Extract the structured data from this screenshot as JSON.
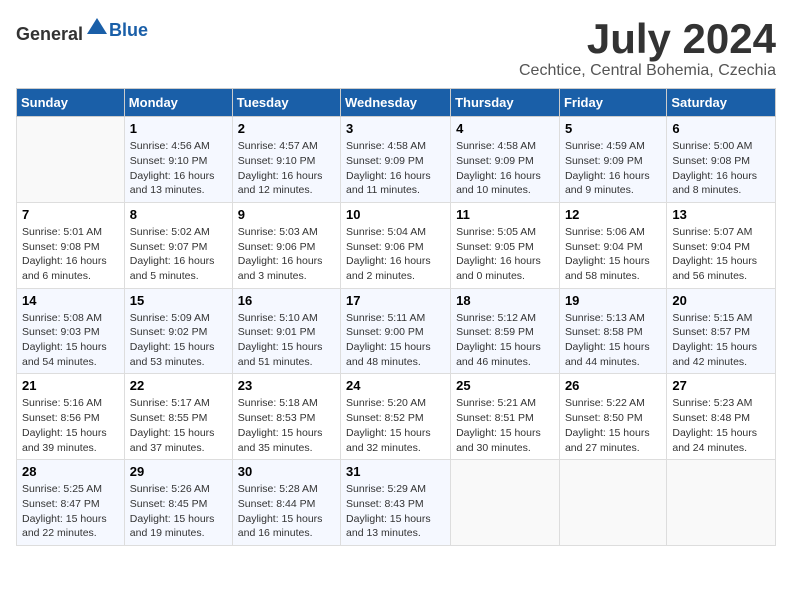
{
  "header": {
    "logo_general": "General",
    "logo_blue": "Blue",
    "month": "July 2024",
    "location": "Cechtice, Central Bohemia, Czechia"
  },
  "weekdays": [
    "Sunday",
    "Monday",
    "Tuesday",
    "Wednesday",
    "Thursday",
    "Friday",
    "Saturday"
  ],
  "weeks": [
    [
      {
        "day": null
      },
      {
        "day": "1",
        "sunrise": "4:56 AM",
        "sunset": "9:10 PM",
        "daylight": "16 hours and 13 minutes."
      },
      {
        "day": "2",
        "sunrise": "4:57 AM",
        "sunset": "9:10 PM",
        "daylight": "16 hours and 12 minutes."
      },
      {
        "day": "3",
        "sunrise": "4:58 AM",
        "sunset": "9:09 PM",
        "daylight": "16 hours and 11 minutes."
      },
      {
        "day": "4",
        "sunrise": "4:58 AM",
        "sunset": "9:09 PM",
        "daylight": "16 hours and 10 minutes."
      },
      {
        "day": "5",
        "sunrise": "4:59 AM",
        "sunset": "9:09 PM",
        "daylight": "16 hours and 9 minutes."
      },
      {
        "day": "6",
        "sunrise": "5:00 AM",
        "sunset": "9:08 PM",
        "daylight": "16 hours and 8 minutes."
      }
    ],
    [
      {
        "day": "7",
        "sunrise": "5:01 AM",
        "sunset": "9:08 PM",
        "daylight": "16 hours and 6 minutes."
      },
      {
        "day": "8",
        "sunrise": "5:02 AM",
        "sunset": "9:07 PM",
        "daylight": "16 hours and 5 minutes."
      },
      {
        "day": "9",
        "sunrise": "5:03 AM",
        "sunset": "9:06 PM",
        "daylight": "16 hours and 3 minutes."
      },
      {
        "day": "10",
        "sunrise": "5:04 AM",
        "sunset": "9:06 PM",
        "daylight": "16 hours and 2 minutes."
      },
      {
        "day": "11",
        "sunrise": "5:05 AM",
        "sunset": "9:05 PM",
        "daylight": "16 hours and 0 minutes."
      },
      {
        "day": "12",
        "sunrise": "5:06 AM",
        "sunset": "9:04 PM",
        "daylight": "15 hours and 58 minutes."
      },
      {
        "day": "13",
        "sunrise": "5:07 AM",
        "sunset": "9:04 PM",
        "daylight": "15 hours and 56 minutes."
      }
    ],
    [
      {
        "day": "14",
        "sunrise": "5:08 AM",
        "sunset": "9:03 PM",
        "daylight": "15 hours and 54 minutes."
      },
      {
        "day": "15",
        "sunrise": "5:09 AM",
        "sunset": "9:02 PM",
        "daylight": "15 hours and 53 minutes."
      },
      {
        "day": "16",
        "sunrise": "5:10 AM",
        "sunset": "9:01 PM",
        "daylight": "15 hours and 51 minutes."
      },
      {
        "day": "17",
        "sunrise": "5:11 AM",
        "sunset": "9:00 PM",
        "daylight": "15 hours and 48 minutes."
      },
      {
        "day": "18",
        "sunrise": "5:12 AM",
        "sunset": "8:59 PM",
        "daylight": "15 hours and 46 minutes."
      },
      {
        "day": "19",
        "sunrise": "5:13 AM",
        "sunset": "8:58 PM",
        "daylight": "15 hours and 44 minutes."
      },
      {
        "day": "20",
        "sunrise": "5:15 AM",
        "sunset": "8:57 PM",
        "daylight": "15 hours and 42 minutes."
      }
    ],
    [
      {
        "day": "21",
        "sunrise": "5:16 AM",
        "sunset": "8:56 PM",
        "daylight": "15 hours and 39 minutes."
      },
      {
        "day": "22",
        "sunrise": "5:17 AM",
        "sunset": "8:55 PM",
        "daylight": "15 hours and 37 minutes."
      },
      {
        "day": "23",
        "sunrise": "5:18 AM",
        "sunset": "8:53 PM",
        "daylight": "15 hours and 35 minutes."
      },
      {
        "day": "24",
        "sunrise": "5:20 AM",
        "sunset": "8:52 PM",
        "daylight": "15 hours and 32 minutes."
      },
      {
        "day": "25",
        "sunrise": "5:21 AM",
        "sunset": "8:51 PM",
        "daylight": "15 hours and 30 minutes."
      },
      {
        "day": "26",
        "sunrise": "5:22 AM",
        "sunset": "8:50 PM",
        "daylight": "15 hours and 27 minutes."
      },
      {
        "day": "27",
        "sunrise": "5:23 AM",
        "sunset": "8:48 PM",
        "daylight": "15 hours and 24 minutes."
      }
    ],
    [
      {
        "day": "28",
        "sunrise": "5:25 AM",
        "sunset": "8:47 PM",
        "daylight": "15 hours and 22 minutes."
      },
      {
        "day": "29",
        "sunrise": "5:26 AM",
        "sunset": "8:45 PM",
        "daylight": "15 hours and 19 minutes."
      },
      {
        "day": "30",
        "sunrise": "5:28 AM",
        "sunset": "8:44 PM",
        "daylight": "15 hours and 16 minutes."
      },
      {
        "day": "31",
        "sunrise": "5:29 AM",
        "sunset": "8:43 PM",
        "daylight": "15 hours and 13 minutes."
      },
      {
        "day": null
      },
      {
        "day": null
      },
      {
        "day": null
      }
    ]
  ]
}
